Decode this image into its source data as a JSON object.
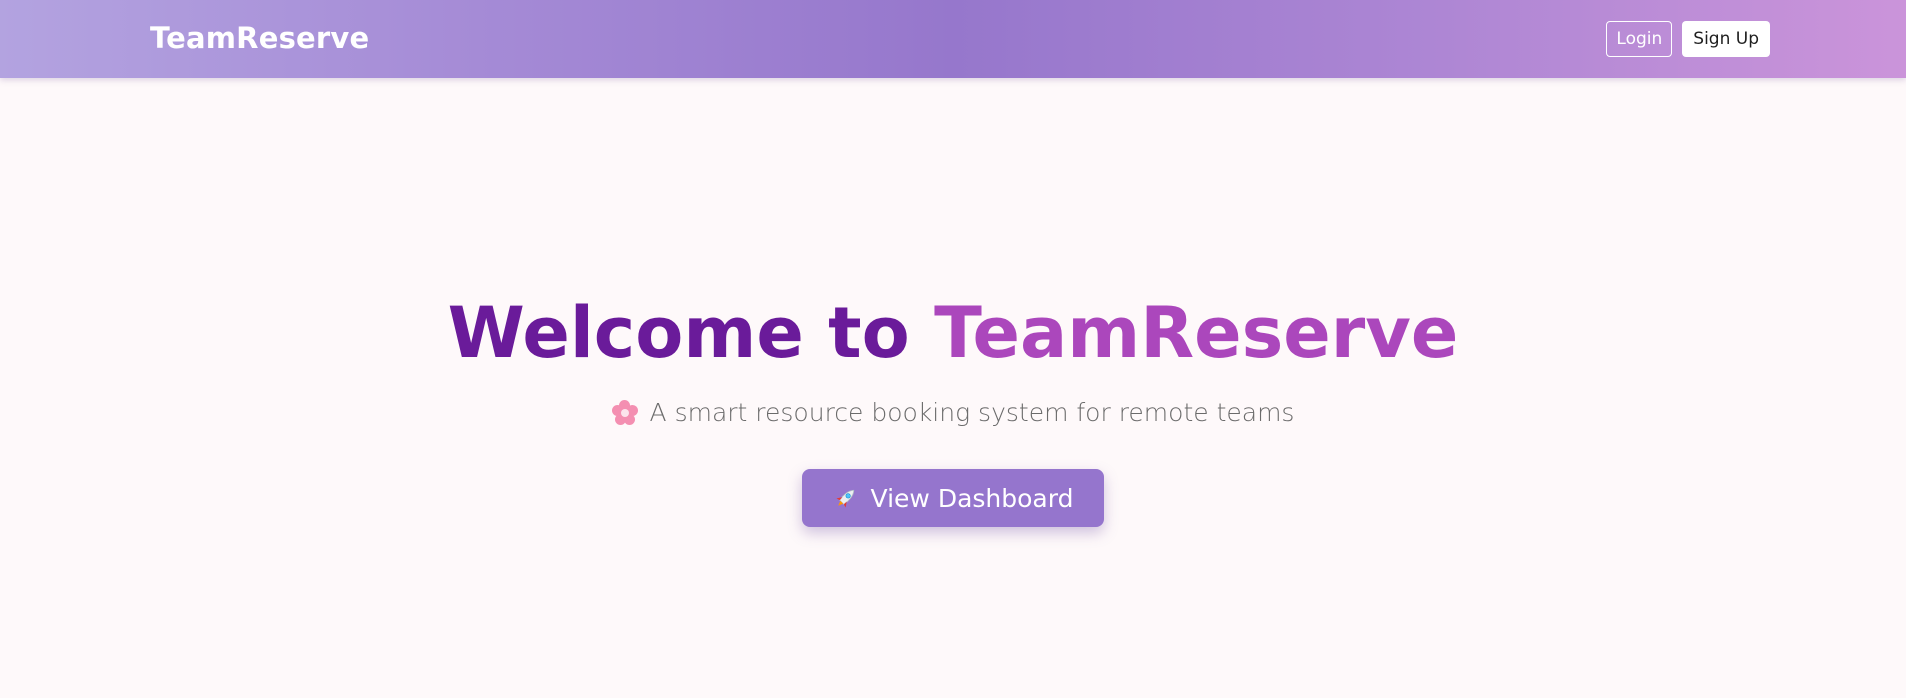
{
  "navbar": {
    "brand": "TeamReserve",
    "login_label": "Login",
    "signup_label": "Sign Up"
  },
  "hero": {
    "title_prefix": "Welcome to ",
    "title_accent": "TeamReserve",
    "subtitle": "A smart resource booking system for remote teams",
    "subtitle_icon": "cherry-blossom-icon",
    "cta_label": "View Dashboard",
    "cta_icon": "rocket-icon"
  },
  "colors": {
    "title": "#6a1b9a",
    "title_accent": "#ab47bc",
    "cta_background": "#9575cd",
    "page_background": "#fef9fa"
  }
}
